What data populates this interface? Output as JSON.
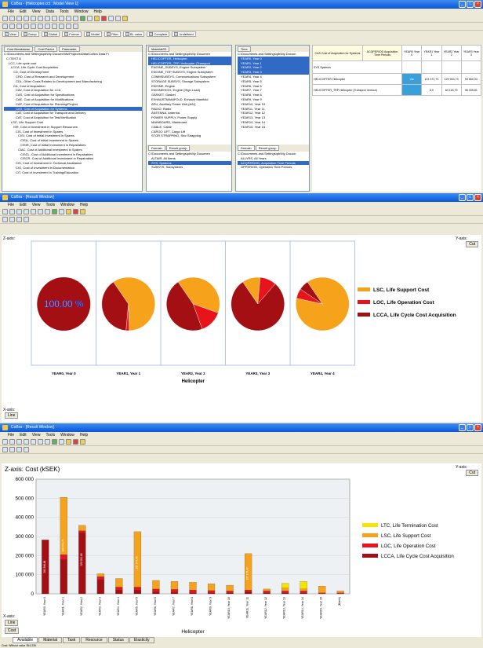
{
  "colors": {
    "ltc": "#f5e400",
    "lsc": "#f7a21b",
    "loc": "#e8141c",
    "lcca": "#a40f14",
    "winblue": "#0a56d8",
    "sel": "#316ac5"
  },
  "win1": {
    "title": "CoBra - [Helicopter.cct : Model View 1]",
    "menu": [
      "File",
      "Edit",
      "View",
      "Data",
      "Tools",
      "Window",
      "Help"
    ],
    "viewbar": [
      "View",
      "Group",
      "Global",
      "Former",
      "Model",
      "Filter",
      "Bl. value",
      "Complete",
      "Undefined"
    ],
    "left_tabs": [
      "Cost Breakdown",
      "Cost Factor",
      "Parameter"
    ],
    "left_tree": [
      "C:\\Documents and Settings\\pb\\My Documents\\Projects\\Data\\CoBra Data Fi",
      "C:\\TEST A",
      "LCC, Life cycle cost",
      "LCCA, Life Cycle Cost Acquisition",
      "CD, Cost of Development",
      "CRD, Cost of Research and Development",
      "CDL, Other Costs Related to Development and Manufacturing",
      "CA, Cost of Acquisition",
      "CAV, Cost of Acquisition for LCA",
      "CAS, Cost of Acquisition for Specifications",
      "CAE, Cost of Acquisition for Modifications",
      "CAP, Cost of Acquisition for Planning/Project",
      "CAS, Cost of Acquisition for Systems",
      "CAT, Cost of Acquisition for Transport and Delivery",
      "CAT, Cost of Acquisition for Test/Verification",
      "LSC, Life Support Cost",
      "ISR, Cost of Investment in Support Resources",
      "CIS, Cost of Investment in Spares",
      "CISI, Cost of Initial Investment in Spares",
      "CISIL, Cost of Initial Investment in Spares",
      "CISIR, Cost of Initial Investment in Repairables",
      "CIAC, Cost of Additional Investment in Spares",
      "CISCL, Cost of Additional Investment in Repairables",
      "CISCR, Cost of Additional Investment in Repairables",
      "CIS, Cost of Investment in Technical Assistance",
      "CIO, Cost of Investment in Documentation",
      "CIT, Cost of Investment in Training/Education"
    ],
    "material_tab": "Material/ID",
    "material_tree": [
      "C:\\Documents and Settings\\pb\\My Documen",
      "HELICOPTER, Helicopter",
      "HELICOPTER_TRP, Helicopter (Transport",
      "ENGINE_SUBSYS, Engine Subsystem",
      "ENGINE_TOP SUBSYS, Engine Subsystem",
      "COMMSUBSYS, Communications Subsystem",
      "STORAGE SUBSYS, Storage Subsystem",
      "ENGINE, Engine",
      "ENGINEHIGH, Engine (High Load)",
      "GASKET, Gasket",
      "EXHAUSTMANIFOLD, Exhaust Manifold",
      "APU, Auxiliary Power Unit (A/U)",
      "RADIO, Radio",
      "ANTENNA, Antenna",
      "POWER SUPPLY, Power Supply",
      "MAINBOARD, Mainboard",
      "CABLE, Cable",
      "CARGO LIFT, Cargo Lift",
      "STOR STRAPPING, Stor Strapping"
    ],
    "domain_tabs": [
      "Domain",
      "Result group"
    ],
    "domain_tree": [
      "C:\\Documents and Settings\\pb\\My Documen",
      "ALTAIR, All Items",
      "SYS, Systems",
      "SUBSYS, Subsystems"
    ],
    "time_tab": "Time",
    "time_tree": [
      "C:\\Documents and Settings\\pb\\My Docum",
      "YEAR0, Year 0",
      "YEAR1, Year 1",
      "YEAR2, Year 2",
      "YEAR3, Year 3",
      "YEAR4, Year 4",
      "YEAR5, Year 5",
      "YEAR6, Year 6",
      "YEAR7, Year 7",
      "YEAR8, Year 8",
      "YEAR9, Year 9",
      "YEAR10, Year 10",
      "YEAR11, Year 11",
      "YEAR12, Year 12",
      "YEAR13, Year 13",
      "YEAR14, Year 14",
      "YEAR15, Year 15"
    ],
    "phase_tabs": [
      "Domain",
      "Result group"
    ],
    "phase_tree": [
      "C:\\Documents and Settings\\pb\\My Docum",
      "ALLYRS, All Years",
      "ACQPERIOD, Acquisition Time Periods",
      "OPPERIOD, Operation Time Periods"
    ],
    "matrix": {
      "corner": "CAS Cost of Acquisition for Systems",
      "col_group": "ACQPERIOD Acquisition Time Periods",
      "cols": [
        "YEAR0 Year 0",
        "YEAR1 Year 1",
        "YEAR2 Year 2",
        "YEAR3 Year 3"
      ],
      "sys_label": "SYS Systems",
      "rows": [
        {
          "name": "HELICOPTER Helicopter",
          "cells": [
            "",
            "Var",
            "123 372,73",
            "129 903,73",
            "93 660,34"
          ]
        },
        {
          "name": "HELICOPTER_TRP Helicopter (Transport Version)",
          "cells": [
            "",
            "",
            "8,0",
            "84 118,79",
            "96 005,81"
          ]
        }
      ]
    }
  },
  "win2": {
    "title": "CoBra - [Result Window]",
    "menu": [
      "File",
      "Edit",
      "View",
      "Tools",
      "Window",
      "Help"
    ],
    "y_axis_label": "Z-axis:",
    "yaxis_btn": "Y-axis:",
    "cut_btn": "Cut",
    "xaxis_label": "X-axis:",
    "line_btn": "Line",
    "first_pie_label": "100,00 %",
    "chart_data": {
      "type": "pie",
      "categories": [
        "YEAR0, Year 0",
        "YEAR1, Year 1",
        "YEAR2, Year 2",
        "YEAR3, Year 3",
        "YEAR4, Year 4"
      ],
      "xlabel": "Helicopter",
      "series": [
        {
          "name": "LSC, Life Support Cost",
          "values": [
            0,
            59,
            40,
            11,
            88
          ]
        },
        {
          "name": "LOC, Life Operation Cost",
          "values": [
            0,
            2,
            14,
            10,
            6
          ]
        },
        {
          "name": "LCCA, Life Cycle Cost Acquisition",
          "values": [
            100,
            39,
            46,
            79,
            6
          ]
        }
      ],
      "legend": "right"
    }
  },
  "win3": {
    "title": "CoBra - [Result Window]",
    "menu": [
      "File",
      "Edit",
      "View",
      "Tools",
      "Window",
      "Help"
    ],
    "z_axis": "Z-axis:",
    "yaxis_btn": "Y-axis:",
    "cut_btn": "Cut",
    "xaxis_label": "X-axis:",
    "line_btn": "Line",
    "cost_btn": "Cost",
    "tabs": [
      "Available",
      "Material",
      "Task",
      "Resource",
      "Status",
      "Elasticity"
    ],
    "status": "Cost: Without value 354,335",
    "chart_data": {
      "type": "bar",
      "title": "Cost (kSEK)",
      "xlabel": "Helicopter",
      "ylim": [
        0,
        600000
      ],
      "yticks": [
        "0",
        "100 000",
        "200 000",
        "300 000",
        "400 000",
        "500 000",
        "600 000"
      ],
      "categories": [
        "YEAR0, Year 0",
        "YEAR1, Year 1",
        "YEAR2, Year 2",
        "YEAR3, Year 3",
        "YEAR4, Year 4",
        "YEAR5, Year 5",
        "YEAR6, Year 6",
        "YEAR7, Year 7",
        "YEAR8, Year 8",
        "YEAR9, Year 9",
        "YEAR10, Year 10",
        "YEAR11, Year 11",
        "YEAR12, Year 12",
        "YEAR13, Year 13",
        "YEAR14, Year 14",
        "YEAR15, Year 15",
        "(Blank)"
      ],
      "series": [
        {
          "name": "LTC, Life Termination Cost",
          "values": [
            0,
            0,
            0,
            0,
            0,
            0,
            0,
            0,
            0,
            0,
            0,
            0,
            0,
            25000,
            40000,
            0,
            0
          ]
        },
        {
          "name": "LSC, Life Support Cost",
          "values": [
            0,
            300000,
            28000,
            15000,
            45000,
            290000,
            45000,
            42000,
            40000,
            35000,
            30000,
            190000,
            10000,
            15000,
            10000,
            35000,
            10000
          ]
        },
        {
          "name": "LOC, Life Operation Cost",
          "values": [
            0,
            25000,
            10000,
            15000,
            15000,
            15000,
            15000,
            15000,
            15000,
            12000,
            10000,
            10000,
            10000,
            10000,
            10000,
            5000,
            5000
          ]
        },
        {
          "name": "LCCA, Life Cycle Cost Acquisition",
          "values": [
            282000,
            180000,
            320000,
            75000,
            20000,
            20000,
            10000,
            8000,
            5000,
            5000,
            5000,
            10000,
            5000,
            5000,
            5000,
            0,
            0
          ]
        }
      ],
      "bar_labels": [
        "281 586,68",
        "180 572,75",
        "320 092,68",
        "",
        "",
        "287 374,48",
        "",
        "",
        "",
        "",
        "",
        "187 178,40",
        "",
        "",
        "",
        "",
        ""
      ],
      "legend": "right"
    }
  }
}
